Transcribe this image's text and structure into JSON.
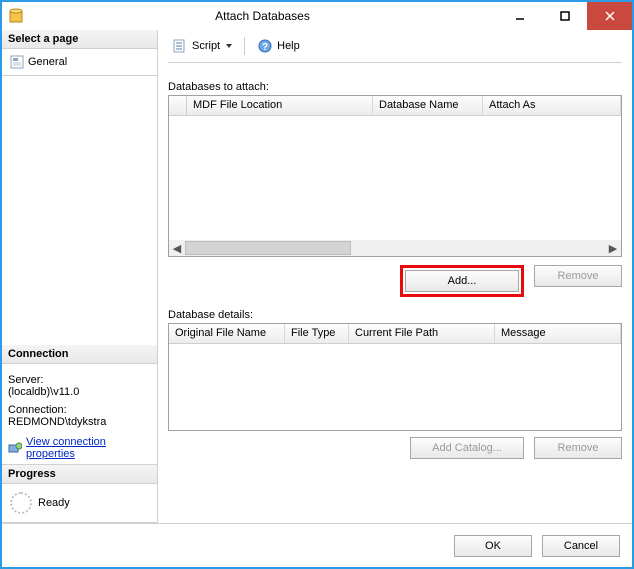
{
  "window": {
    "title": "Attach Databases"
  },
  "left": {
    "select_page_header": "Select a page",
    "general_item": "General",
    "connection_header": "Connection",
    "server_label": "Server:",
    "server_value": "(localdb)\\v11.0",
    "connection_label": "Connection:",
    "connection_value": "REDMOND\\tdykstra",
    "view_conn_props": "View connection properties",
    "progress_header": "Progress",
    "progress_status": "Ready"
  },
  "toolbar": {
    "script": "Script",
    "help": "Help"
  },
  "main": {
    "databases_to_attach": "Databases to attach:",
    "cols1": {
      "mdf": "MDF File Location",
      "dbname": "Database Name",
      "attach_as": "Attach As"
    },
    "add": "Add...",
    "remove1": "Remove",
    "database_details": "Database details:",
    "cols2": {
      "ofn": "Original File Name",
      "ft": "File Type",
      "cfp": "Current File Path",
      "msg": "Message"
    },
    "add_catalog": "Add Catalog...",
    "remove2": "Remove"
  },
  "footer": {
    "ok": "OK",
    "cancel": "Cancel"
  }
}
